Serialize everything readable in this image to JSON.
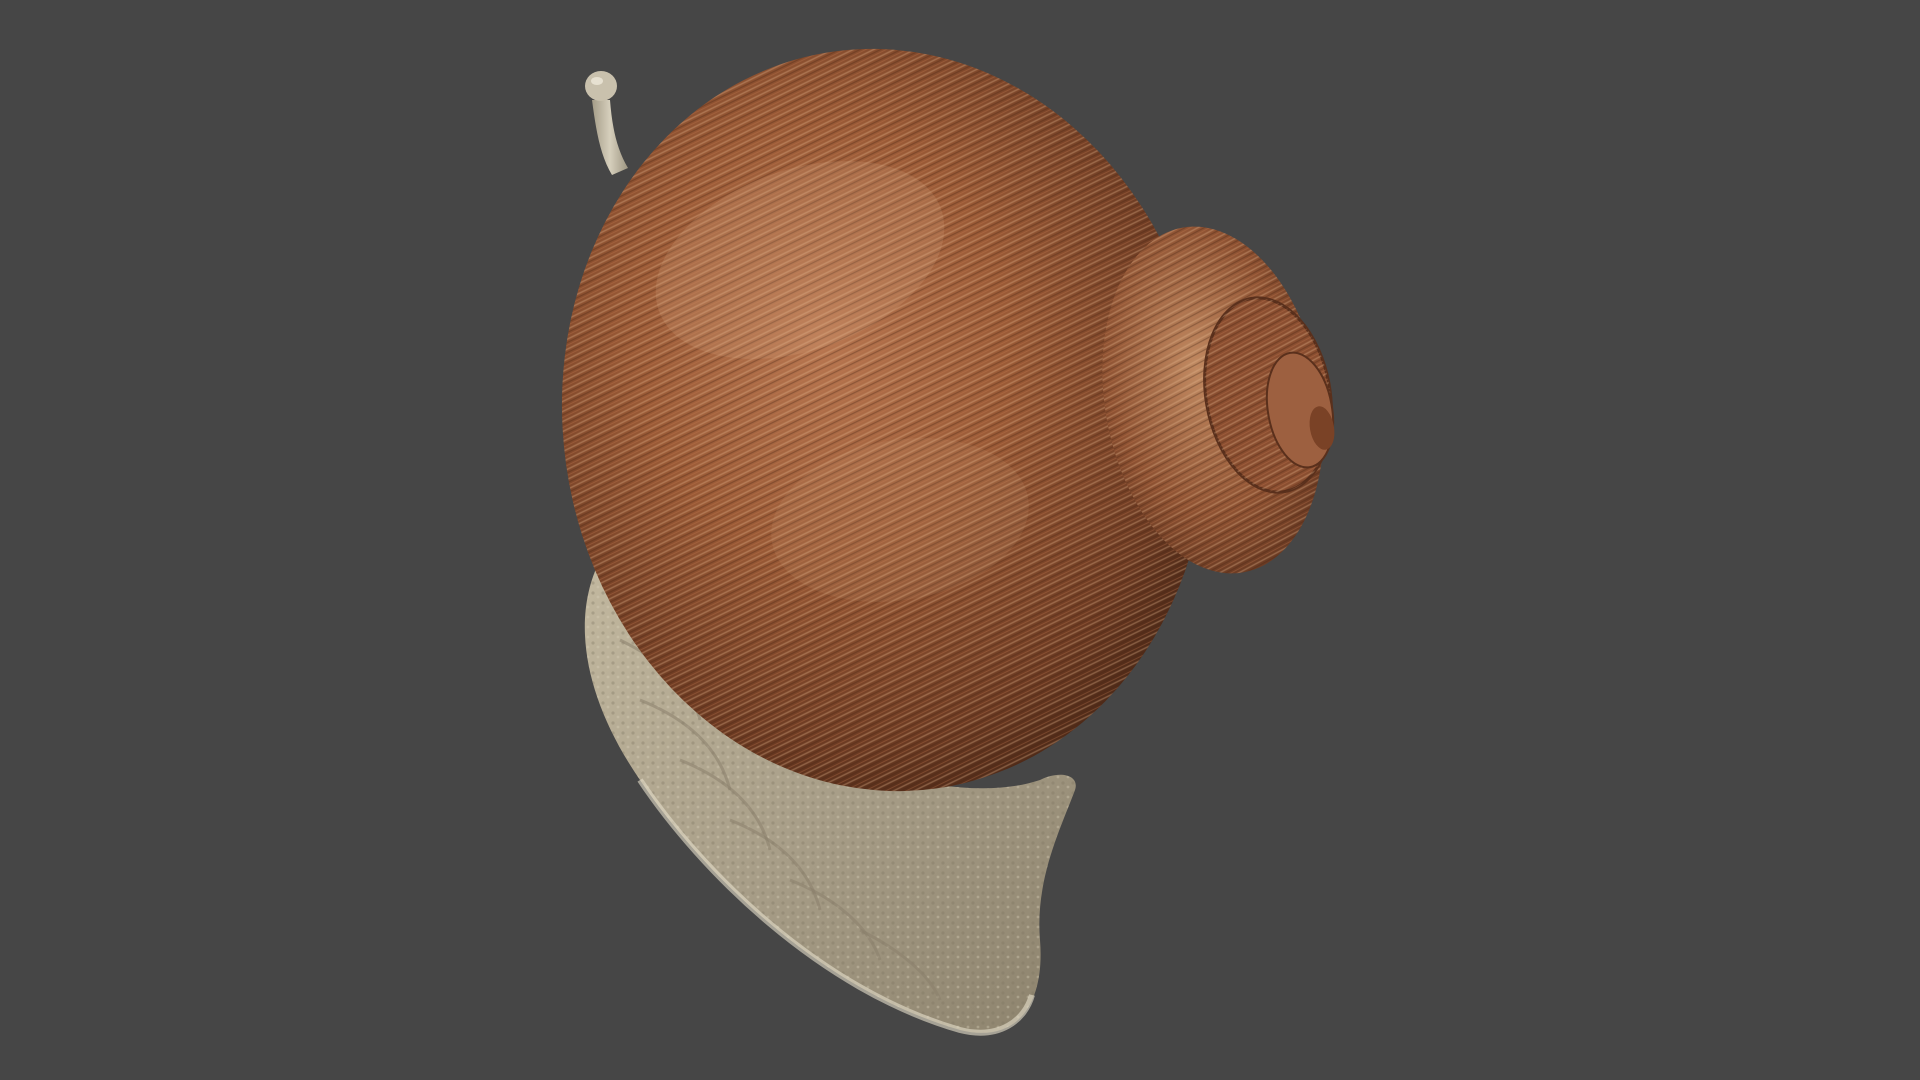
{
  "scene": {
    "subject": "snail-3d-model",
    "colors": {
      "background": "#464646",
      "shell_dark": "#6b3a22",
      "shell_mid": "#9a5a36",
      "shell_light": "#c99a72",
      "body": "#a89e88",
      "body_light": "#c9c0aa",
      "tentacle": "#bdb5a0"
    }
  }
}
